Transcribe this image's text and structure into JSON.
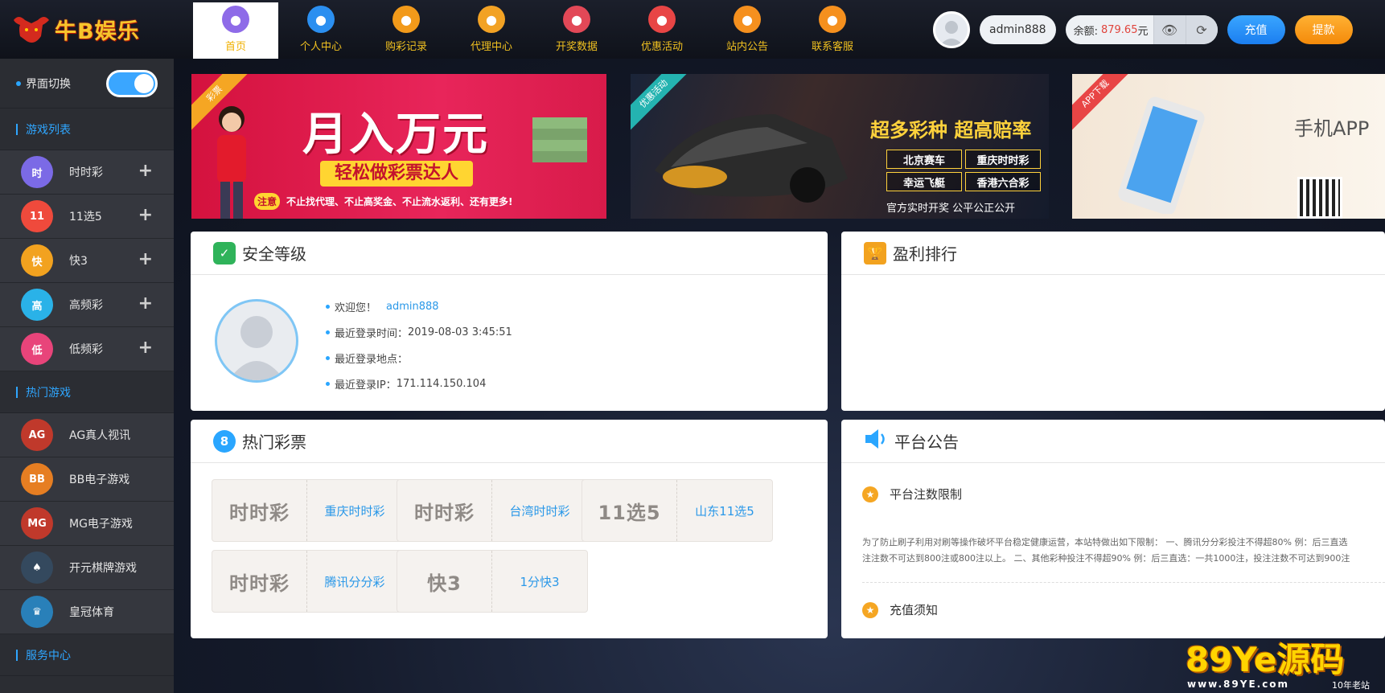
{
  "brand": {
    "name": "牛B娱乐"
  },
  "nav": [
    {
      "label": "首页",
      "icon": "home-icon",
      "color": "#8e6be8"
    },
    {
      "label": "个人中心",
      "icon": "user-icon",
      "color": "#2b8ff0"
    },
    {
      "label": "购彩记录",
      "icon": "lottery-icon",
      "color": "#f29a1a"
    },
    {
      "label": "代理中心",
      "icon": "agents-icon",
      "color": "#f2a224"
    },
    {
      "label": "开奖数据",
      "icon": "data-icon",
      "color": "#e24857"
    },
    {
      "label": "优惠活动",
      "icon": "gift-icon",
      "color": "#e84545"
    },
    {
      "label": "站内公告",
      "icon": "chat-icon",
      "color": "#f5901e"
    },
    {
      "label": "联系客服",
      "icon": "headset-icon",
      "color": "#f5901e"
    }
  ],
  "user": {
    "name": "admin888",
    "balance_label": "余额:",
    "balance_value": "879.65",
    "balance_unit": "元",
    "recharge": "充值",
    "withdraw": "提款"
  },
  "sidebar": {
    "switch_label": "界面切换",
    "games_title": "游戏列表",
    "games": [
      {
        "label": "时时彩",
        "icon": "ssc-icon",
        "glyph": "时",
        "color": "#7b6ae6"
      },
      {
        "label": "11选5",
        "icon": "11x5-icon",
        "glyph": "11",
        "color": "#ef4a3c"
      },
      {
        "label": "快3",
        "icon": "k3-icon",
        "glyph": "快",
        "color": "#f2a21f"
      },
      {
        "label": "高频彩",
        "icon": "high-freq-icon",
        "glyph": "高",
        "color": "#2ab2e8"
      },
      {
        "label": "低频彩",
        "icon": "low-freq-icon",
        "glyph": "低",
        "color": "#e8447a"
      }
    ],
    "hot_title": "热门游戏",
    "hot": [
      {
        "label": "AG真人视讯",
        "icon": "ag-icon",
        "glyph": "AG",
        "color": "#c0392b"
      },
      {
        "label": "BB电子游戏",
        "icon": "bb-icon",
        "glyph": "BB",
        "color": "#e67e22"
      },
      {
        "label": "MG电子游戏",
        "icon": "mg-icon",
        "glyph": "MG",
        "color": "#c0392b"
      },
      {
        "label": "开元棋牌游戏",
        "icon": "chess-icon",
        "glyph": "♠",
        "color": "#34495e"
      },
      {
        "label": "皇冠体育",
        "icon": "crown-icon",
        "glyph": "♛",
        "color": "#2980b9"
      }
    ],
    "service_title": "服务中心"
  },
  "banners": [
    {
      "ribbon": "彩票",
      "headline": "月入万元",
      "sub": "轻松做彩票达人",
      "note_tag": "注意",
      "note": "不止找代理、不止高奖金、不止流水返利、还有更多!"
    },
    {
      "ribbon": "优惠活动",
      "headline": "超多彩种 超高赔率",
      "tags": [
        "北京赛车",
        "重庆时时彩",
        "幸运飞艇",
        "香港六合彩"
      ],
      "foot": "官方实时开奖  公平公正公开"
    },
    {
      "ribbon": "APP下载",
      "headline": "手机APP"
    }
  ],
  "security": {
    "title": "安全等级",
    "welcome_label": "欢迎您！",
    "welcome_user": "admin888",
    "last_login_time_label": "最近登录时间：",
    "last_login_time": "2019-08-03 3:45:51",
    "last_login_place_label": "最近登录地点：",
    "last_login_ip_label": "最近登录IP：",
    "last_login_ip": "171.114.150.104"
  },
  "ranking": {
    "title": "盈利排行"
  },
  "hot_lottery": {
    "title": "热门彩票",
    "items": [
      {
        "logo": "时时彩",
        "name": "重庆时时彩"
      },
      {
        "logo": "时时彩",
        "name": "台湾时时彩"
      },
      {
        "logo": "11选5",
        "name": "山东11选5"
      },
      {
        "logo": "时时彩",
        "name": "腾讯分分彩"
      },
      {
        "logo": "快3",
        "name": "1分快3"
      }
    ]
  },
  "notice": {
    "title": "平台公告",
    "items": [
      {
        "title": "平台注数限制",
        "text_line1": "为了防止刷子利用对刷等操作破坏平台稳定健康运营，本站特做出如下限制： 一、腾讯分分彩投注不得超80% 例：后三直选",
        "text_line2": "注注数不可达到800注或800注以上。 二、其他彩种投注不得超90% 例：后三直选：一共1000注，投注注数不可达到900注"
      },
      {
        "title": "充值须知"
      }
    ]
  },
  "watermark": {
    "text": "89Ye源码",
    "url": "www.89YE.com",
    "tag": "10年老站"
  }
}
